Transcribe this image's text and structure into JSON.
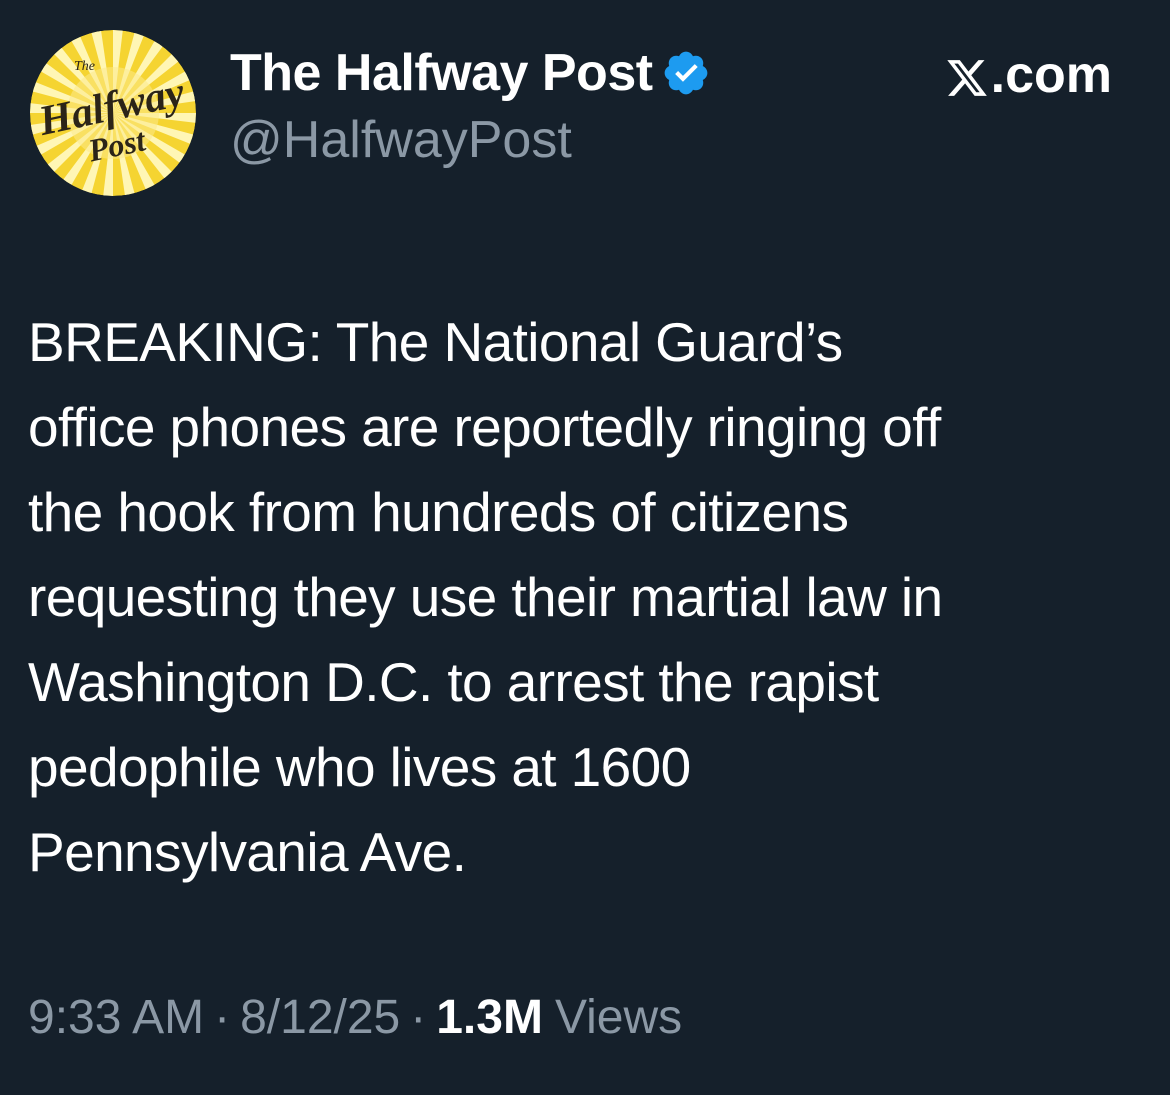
{
  "tweet": {
    "author": {
      "display_name": "The Halfway Post",
      "handle": "@HalfwayPost",
      "verified": true,
      "avatar_icon": "halfway-post-sunburst-logo",
      "avatar_text_small": "The",
      "avatar_text_line1": "Halfway",
      "avatar_text_line2": "Post"
    },
    "source_label": ".com",
    "source_icon": "x-logo-icon",
    "text": "BREAKING: The National Guard’s\noffice phones are reportedly ringing off\nthe hook from hundreds of citizens\nrequesting they use their martial law in\nWashington D.C. to arrest the rapist\npedophile who lives at 1600\nPennsylvania Ave.",
    "time": "9:33 AM",
    "date": "8/12/25",
    "separator": "·",
    "views_count": "1.3M",
    "views_label": "Views"
  },
  "colors": {
    "background": "#15202b",
    "text": "#ffffff",
    "muted": "#8b98a5",
    "verified_badge": "#1d9bf0",
    "avatar_yellow": "#f5d431",
    "avatar_ray": "#fff4a8"
  }
}
